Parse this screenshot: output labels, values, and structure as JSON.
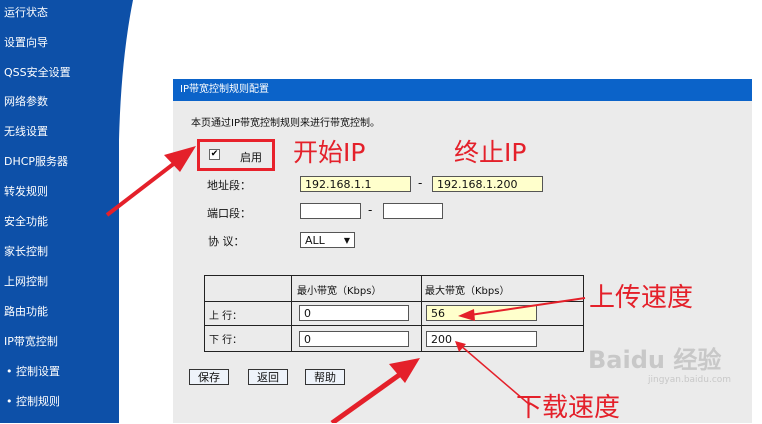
{
  "sidebar": {
    "items": [
      {
        "label": "运行状态"
      },
      {
        "label": "设置向导"
      },
      {
        "label": "QSS安全设置"
      },
      {
        "label": "网络参数"
      },
      {
        "label": "无线设置"
      },
      {
        "label": "DHCP服务器"
      },
      {
        "label": "转发规则"
      },
      {
        "label": "安全功能"
      },
      {
        "label": "家长控制"
      },
      {
        "label": "上网控制"
      },
      {
        "label": "路由功能"
      },
      {
        "label": "IP带宽控制"
      },
      {
        "label": "• 控制设置"
      },
      {
        "label": "• 控制规则"
      }
    ]
  },
  "panel": {
    "title": "IP带宽控制规则配置",
    "description": "本页通过IP带宽控制规则来进行带宽控制。",
    "enable_label": "启用",
    "enable_checked": "✔",
    "address_label": "地址段：",
    "start_ip": "192.168.1.1",
    "end_ip": "192.168.1.200",
    "port_label": "端口段：",
    "port_start": "",
    "port_end": "",
    "protocol_label": "协 议：",
    "protocol_value": "ALL",
    "range_separator": "-",
    "table": {
      "col_min": "最小带宽（Kbps）",
      "col_max": "最大带宽（Kbps）",
      "up_label": "上 行：",
      "down_label": "下 行：",
      "up_min": "0",
      "up_max": "56",
      "down_min": "0",
      "down_max": "200"
    },
    "buttons": {
      "save": "保存",
      "back": "返回",
      "help": "帮助"
    }
  },
  "annotations": {
    "start_ip": "开始IP",
    "end_ip": "终止IP",
    "upload_speed": "上传速度",
    "download_speed": "下载速度",
    "color": "#e4202a"
  },
  "watermark": {
    "text": "Baidu 经验",
    "sub": "jingyan.baidu.com"
  },
  "colors": {
    "sidebar": "#0d50a8",
    "header": "#0b63c9",
    "panel": "#ebebeb",
    "field_highlight": "#ffffcc"
  }
}
